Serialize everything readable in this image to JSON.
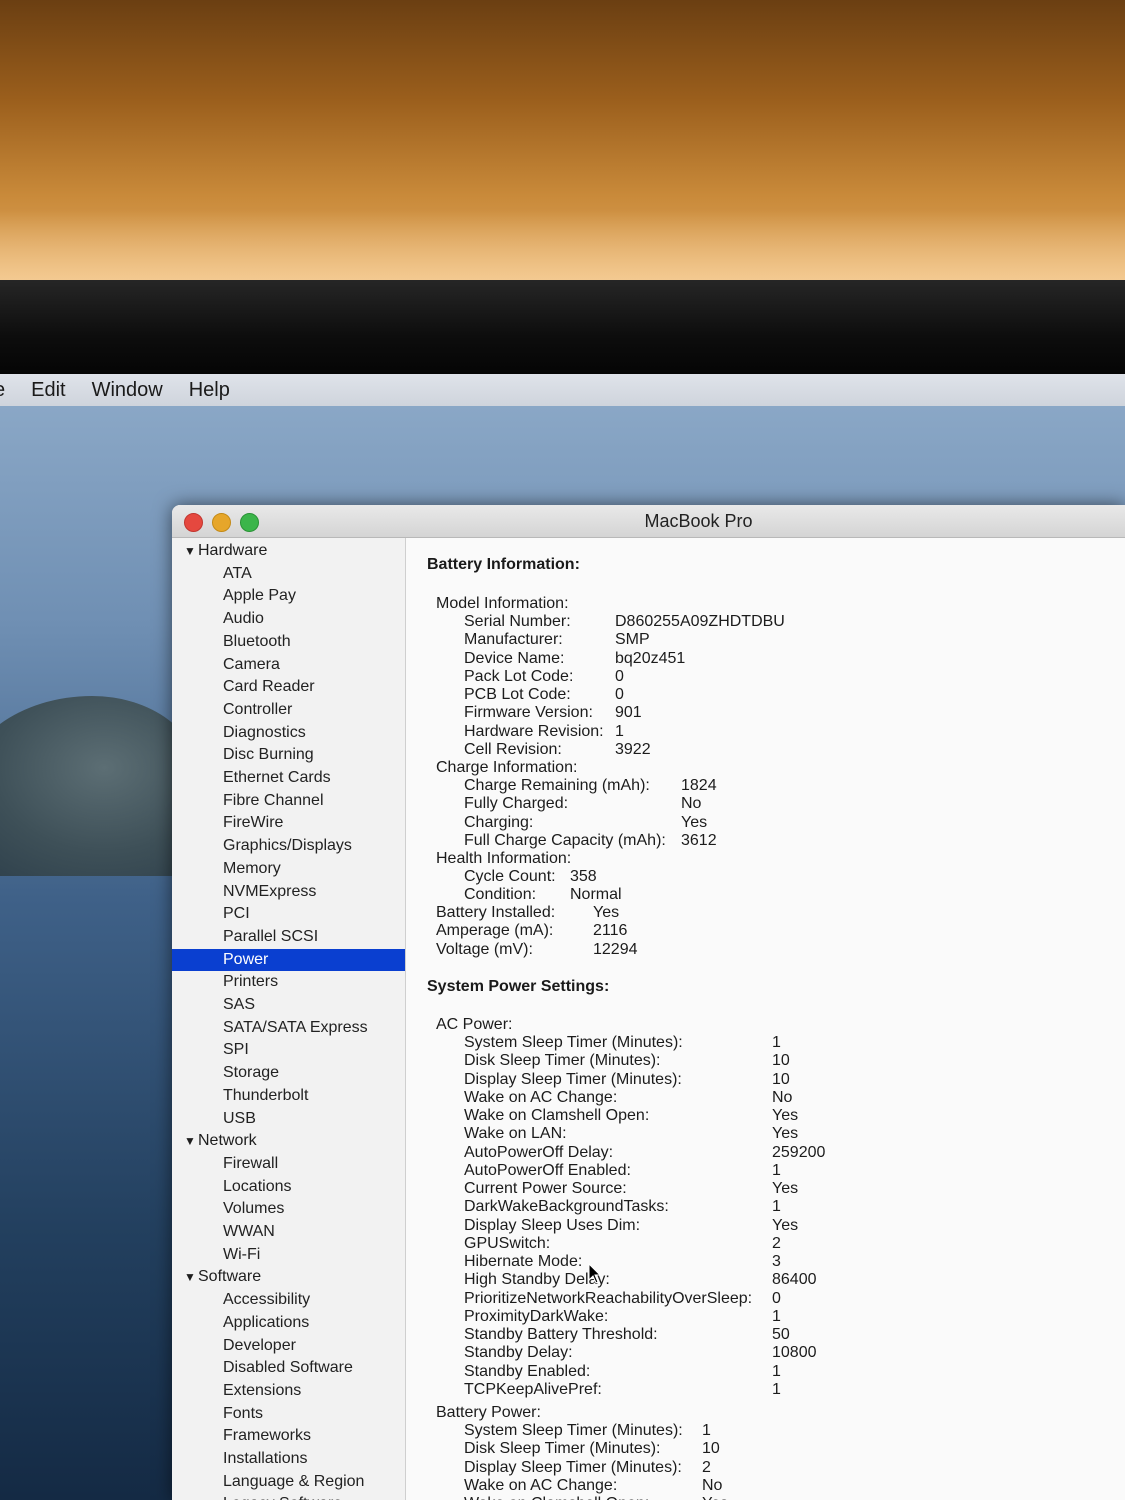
{
  "menubar": {
    "items": [
      "e",
      "Edit",
      "Window",
      "Help"
    ]
  },
  "window": {
    "title": "MacBook Pro"
  },
  "sidebar": {
    "categories": [
      {
        "label": "Hardware",
        "items": [
          "ATA",
          "Apple Pay",
          "Audio",
          "Bluetooth",
          "Camera",
          "Card Reader",
          "Controller",
          "Diagnostics",
          "Disc Burning",
          "Ethernet Cards",
          "Fibre Channel",
          "FireWire",
          "Graphics/Displays",
          "Memory",
          "NVMExpress",
          "PCI",
          "Parallel SCSI",
          "Power",
          "Printers",
          "SAS",
          "SATA/SATA Express",
          "SPI",
          "Storage",
          "Thunderbolt",
          "USB"
        ]
      },
      {
        "label": "Network",
        "items": [
          "Firewall",
          "Locations",
          "Volumes",
          "WWAN",
          "Wi-Fi"
        ]
      },
      {
        "label": "Software",
        "items": [
          "Accessibility",
          "Applications",
          "Developer",
          "Disabled Software",
          "Extensions",
          "Fonts",
          "Frameworks",
          "Installations",
          "Language & Region",
          "Legacy Software"
        ]
      }
    ],
    "selected": "Power"
  },
  "battery": {
    "heading": "Battery Information:",
    "model_label": "Model Information:",
    "model": [
      [
        "Serial Number:",
        "D860255A09ZHDTDBU"
      ],
      [
        "Manufacturer:",
        "SMP"
      ],
      [
        "Device Name:",
        "bq20z451"
      ],
      [
        "Pack Lot Code:",
        "0"
      ],
      [
        "PCB Lot Code:",
        "0"
      ],
      [
        "Firmware Version:",
        "901"
      ],
      [
        "Hardware Revision:",
        "1"
      ],
      [
        "Cell Revision:",
        "3922"
      ]
    ],
    "charge_label": "Charge Information:",
    "charge": [
      [
        "Charge Remaining (mAh):",
        "1824"
      ],
      [
        "Fully Charged:",
        "No"
      ],
      [
        "Charging:",
        "Yes"
      ],
      [
        "Full Charge Capacity (mAh):",
        "3612"
      ]
    ],
    "health_label": "Health Information:",
    "health": [
      [
        "Cycle Count:",
        "358"
      ],
      [
        "Condition:",
        "Normal"
      ]
    ],
    "misc": [
      [
        "Battery Installed:",
        "Yes"
      ],
      [
        "Amperage (mA):",
        "2116"
      ],
      [
        "Voltage (mV):",
        "12294"
      ]
    ]
  },
  "power": {
    "heading": "System Power Settings:",
    "ac_label": "AC Power:",
    "ac": [
      [
        "System Sleep Timer (Minutes):",
        "1"
      ],
      [
        "Disk Sleep Timer (Minutes):",
        "10"
      ],
      [
        "Display Sleep Timer (Minutes):",
        "10"
      ],
      [
        "Wake on AC Change:",
        "No"
      ],
      [
        "Wake on Clamshell Open:",
        "Yes"
      ],
      [
        "Wake on LAN:",
        "Yes"
      ],
      [
        "AutoPowerOff Delay:",
        "259200"
      ],
      [
        "AutoPowerOff Enabled:",
        "1"
      ],
      [
        "Current Power Source:",
        "Yes"
      ],
      [
        "DarkWakeBackgroundTasks:",
        "1"
      ],
      [
        "Display Sleep Uses Dim:",
        "Yes"
      ],
      [
        "GPUSwitch:",
        "2"
      ],
      [
        "Hibernate Mode:",
        "3"
      ],
      [
        "High Standby Delay:",
        "86400"
      ],
      [
        "PrioritizeNetworkReachabilityOverSleep:",
        "0"
      ],
      [
        "ProximityDarkWake:",
        "1"
      ],
      [
        "Standby Battery Threshold:",
        "50"
      ],
      [
        "Standby Delay:",
        "10800"
      ],
      [
        "Standby Enabled:",
        "1"
      ],
      [
        "TCPKeepAlivePref:",
        "1"
      ]
    ],
    "battery_label": "Battery Power:",
    "battery": [
      [
        "System Sleep Timer (Minutes):",
        "1"
      ],
      [
        "Disk Sleep Timer (Minutes):",
        "10"
      ],
      [
        "Display Sleep Timer (Minutes):",
        "2"
      ],
      [
        "Wake on AC Change:",
        "No"
      ],
      [
        "Wake on Clamshell Open:",
        "Yes"
      ]
    ]
  }
}
